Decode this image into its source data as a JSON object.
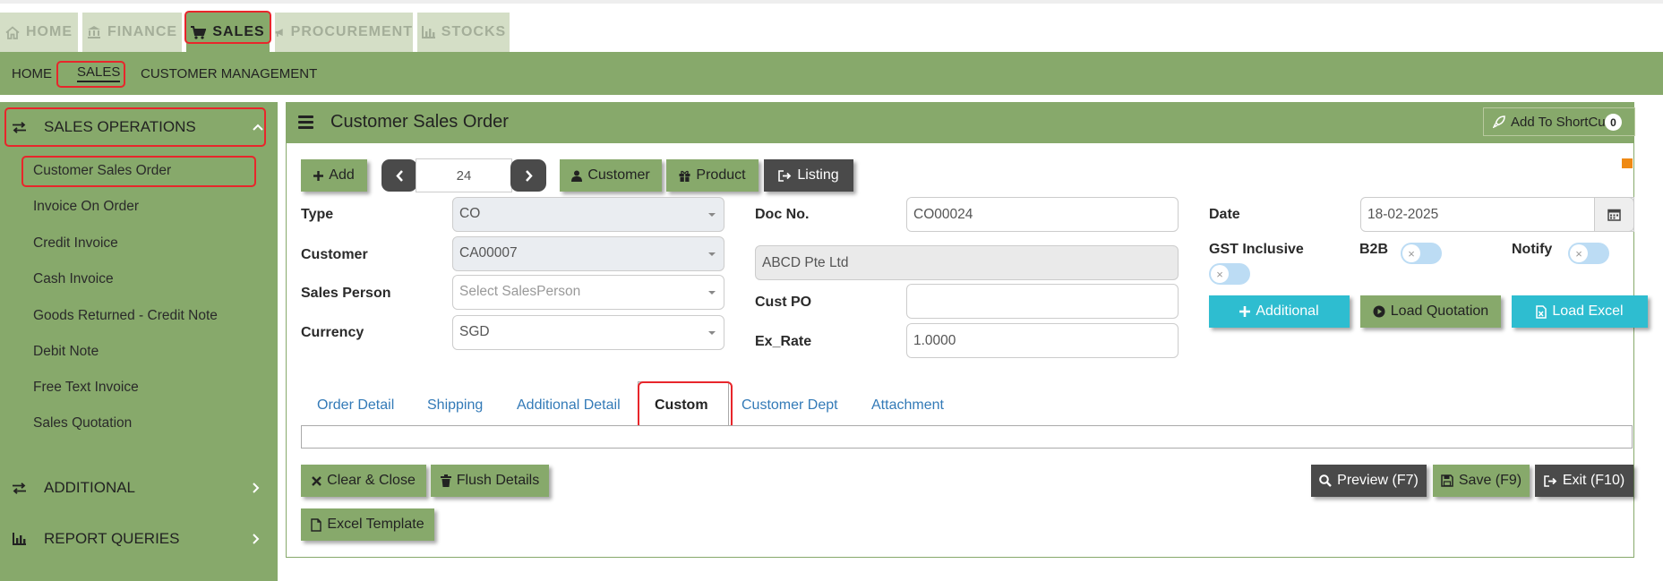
{
  "module_tabs": [
    {
      "label": "HOME",
      "icon": "home-icon"
    },
    {
      "label": "FINANCE",
      "icon": "bank-icon"
    },
    {
      "label": "SALES",
      "icon": "shopping-cart-icon",
      "active": true
    },
    {
      "label": "PROCUREMENT",
      "icon": "megaphone-icon"
    },
    {
      "label": "STOCKS",
      "icon": "bar-chart-icon"
    }
  ],
  "sub_nav": [
    "HOME",
    "SALES",
    "CUSTOMER MANAGEMENT"
  ],
  "sidebar": {
    "sections": [
      {
        "label": "SALES OPERATIONS",
        "icon": "exchange-icon",
        "chevron": "chevron-up-icon"
      },
      {
        "label": "ADDITIONAL",
        "icon": "exchange-icon",
        "chevron": "chevron-right-icon"
      },
      {
        "label": "REPORT QUERIES",
        "icon": "bar-chart-icon",
        "chevron": "chevron-right-icon"
      }
    ],
    "items": [
      "Customer Sales Order",
      "Invoice On Order",
      "Credit Invoice",
      "Cash Invoice",
      "Goods Returned - Credit Note",
      "Debit Note",
      "Free Text Invoice",
      "Sales Quotation"
    ]
  },
  "panel": {
    "title": "Customer Sales Order",
    "shortcut_label": "Add To ShortCut",
    "shortcut_count": "0"
  },
  "toolbar": {
    "add": "Add",
    "record_number": "24",
    "customer": "Customer",
    "product": "Product",
    "listing": "Listing"
  },
  "form": {
    "type_label": "Type",
    "type_value": "CO",
    "customer_label": "Customer",
    "customer_value": "CA00007",
    "sales_person_label": "Sales Person",
    "sales_person_placeholder": "Select SalesPerson",
    "currency_label": "Currency",
    "currency_value": "SGD",
    "doc_no_label": "Doc No.",
    "doc_no_value": "CO00024",
    "customer_name_value": "ABCD Pte Ltd",
    "cust_po_label": "Cust PO",
    "cust_po_value": "",
    "ex_rate_label": "Ex_Rate",
    "ex_rate_value": "1.0000",
    "date_label": "Date",
    "date_value": "18-02-2025",
    "gst_inclusive_label": "GST Inclusive",
    "b2b_label": "B2B",
    "notify_label": "Notify"
  },
  "action_buttons": {
    "additional": "Additional",
    "load_quotation": "Load Quotation",
    "load_excel": "Load Excel"
  },
  "tabs": [
    "Order Detail",
    "Shipping",
    "Additional Detail",
    "Custom",
    "Customer Dept",
    "Attachment"
  ],
  "active_tab": "Custom",
  "footer": {
    "clear_close": "Clear & Close",
    "flush_details": "Flush Details",
    "excel_template": "Excel Template",
    "preview": "Preview (F7)",
    "save": "Save (F9)",
    "exit": "Exit (F10)"
  },
  "colors": {
    "brand_green": "#87a96b",
    "inactive_tab": "#d4dec6",
    "dark_button": "#4a4a4a",
    "cyan_button": "#2ebdd0",
    "highlight_red": "#e8262b",
    "link_blue": "#337ab7",
    "indicator_orange": "#ef8a14"
  }
}
